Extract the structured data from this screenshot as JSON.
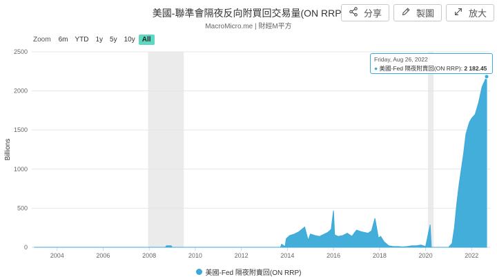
{
  "header": {
    "title": "美國-聯準會隔夜反向附買回交易量(ON RRP)",
    "subtitle": "MacroMicro.me | 財經M平方"
  },
  "toolbar": {
    "share_label": "分享",
    "draw_label": "製圖",
    "expand_label": "放大"
  },
  "zoom": {
    "label": "Zoom",
    "options": [
      "6m",
      "YTD",
      "1y",
      "5y",
      "10y",
      "All"
    ],
    "active": "All"
  },
  "tooltip": {
    "date": "Friday, Aug 26, 2022",
    "series": "美國-Fed 隔夜附賣回(ON RRP):",
    "value": "2 182.45"
  },
  "colors": {
    "series": "#3aaad8",
    "recession_band": "#ebebeb",
    "zoom_active": "#5ed8c0"
  },
  "chart_data": {
    "type": "area",
    "ylabel": "Billions",
    "ylim": [
      0,
      2500
    ],
    "yticks": [
      0,
      500,
      1000,
      1500,
      2000,
      2500
    ],
    "xlim": [
      2002.9,
      2022.8
    ],
    "xticks": [
      2004,
      2006,
      2008,
      2010,
      2012,
      2014,
      2016,
      2018,
      2020,
      2022
    ],
    "xtick_labels": [
      "2004",
      "2006",
      "2008",
      "2010",
      "2012",
      "2014",
      "2016",
      "2018",
      "2020",
      "2022"
    ],
    "shaded_periods": [
      [
        2007.95,
        2009.5
      ],
      [
        2020.1,
        2020.35
      ]
    ],
    "legend": {
      "position": "bottom-center"
    },
    "grid": true,
    "series": [
      {
        "name": "美國-Fed 隔夜附賣回(ON RRP)",
        "x": [
          2003.0,
          2008.7,
          2008.75,
          2008.95,
          2009.0,
          2013.7,
          2013.75,
          2013.9,
          2013.95,
          2014.1,
          2014.3,
          2014.5,
          2014.75,
          2014.9,
          2015.0,
          2015.2,
          2015.4,
          2015.6,
          2015.75,
          2015.9,
          2016.0,
          2016.05,
          2016.2,
          2016.4,
          2016.6,
          2016.8,
          2017.0,
          2017.2,
          2017.5,
          2017.65,
          2017.8,
          2017.95,
          2018.05,
          2018.2,
          2018.4,
          2018.6,
          2018.8,
          2019.0,
          2019.2,
          2019.4,
          2019.6,
          2019.8,
          2020.0,
          2020.2,
          2020.25,
          2020.4,
          2020.6,
          2021.0,
          2021.15,
          2021.25,
          2021.35,
          2021.45,
          2021.55,
          2021.65,
          2021.75,
          2021.9,
          2022.0,
          2022.15,
          2022.3,
          2022.45,
          2022.6,
          2022.65
        ],
        "values": [
          0,
          0,
          20,
          20,
          0,
          0,
          40,
          10,
          110,
          150,
          170,
          200,
          260,
          90,
          170,
          150,
          140,
          170,
          190,
          230,
          470,
          160,
          140,
          150,
          180,
          140,
          220,
          200,
          180,
          210,
          370,
          120,
          140,
          70,
          20,
          10,
          10,
          5,
          10,
          20,
          20,
          30,
          10,
          290,
          0,
          0,
          0,
          0,
          50,
          250,
          550,
          800,
          1000,
          1200,
          1450,
          1600,
          1650,
          1700,
          1850,
          2050,
          2150,
          2182.45
        ]
      }
    ]
  }
}
